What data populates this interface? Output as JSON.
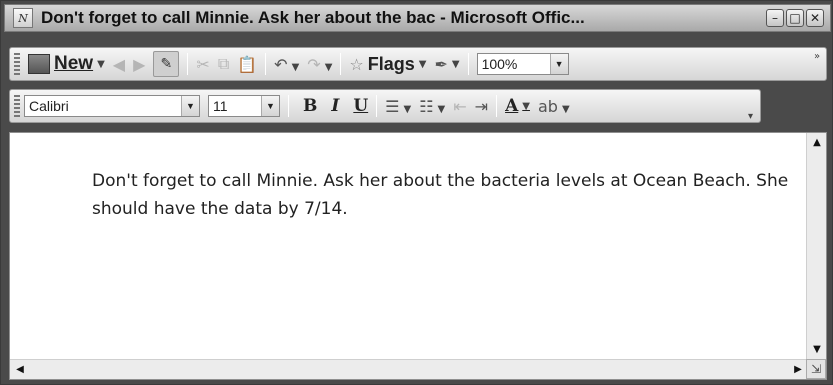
{
  "window": {
    "title": "Don't forget to call Minnie. Ask her about the bac - Microsoft Offic...",
    "app_icon": "onenote-icon"
  },
  "toolbar_main": {
    "new_label": "New",
    "flags_label": "Flags",
    "zoom_value": "100%",
    "icons": [
      "note-icon",
      "back-icon",
      "forward-icon",
      "pushpin-icon",
      "cut-icon",
      "copy-icon",
      "paste-icon",
      "undo-icon",
      "redo-icon",
      "flag-icon",
      "pen-icon"
    ]
  },
  "toolbar_format": {
    "font_name": "Calibri",
    "font_size": "11",
    "bold": "B",
    "italic": "I",
    "underline": "U",
    "icons": [
      "bullets-icon",
      "numbering-icon",
      "decrease-indent-icon",
      "increase-indent-icon",
      "font-color-icon",
      "highlight-icon"
    ]
  },
  "note": {
    "text": "Don't forget to call Minnie. Ask her about the bacteria levels at Ocean Beach. She should have the data by 7/14."
  }
}
